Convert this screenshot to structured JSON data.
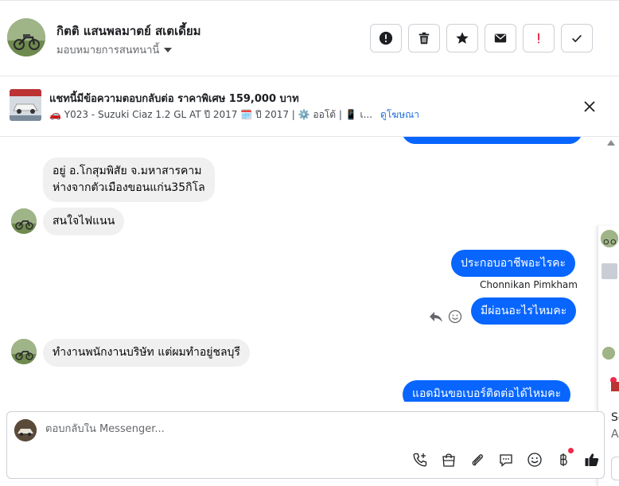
{
  "header": {
    "contact_name": "กิตติ แสนพลมาตย์ สเตเดี้ยม",
    "assign_label": "มอบหมายการสนทนานี้"
  },
  "actions": [
    {
      "name": "spam-button",
      "icon": "exclamation-circle-icon"
    },
    {
      "name": "delete-button",
      "icon": "trash-icon"
    },
    {
      "name": "star-button",
      "icon": "star-icon"
    },
    {
      "name": "mark-unread-button",
      "icon": "envelope-icon"
    },
    {
      "name": "mark-followup-button",
      "icon": "red-exclamation-icon"
    },
    {
      "name": "mark-done-button",
      "icon": "checkmark-icon"
    }
  ],
  "ad": {
    "title": "แชทนี้มีข้อความตอบกลับต่อ ราคาพิเศษ 159,000 บาท",
    "details": "🚗 Y023 - Suzuki Ciaz 1.2 GL AT ปี 2017 🗓️ ปี 2017 | ⚙️ ออโต้ | 📱 เ...",
    "link": "ดูโฆษณา"
  },
  "messages": {
    "in_1_line1": "อยู่ อ.โกสุมพิสัย จ.มหาสารคาม",
    "in_1_line2": "ห่างจากตัวเมืองขอนแก่น35กิโล",
    "in_2": "สนใจไฟแนน",
    "out_1": "ประกอบอาชีพอะไรคะ",
    "sender": "Chonnikan Pimkham",
    "out_2": "มีผ่อนอะไรไหมคะ",
    "in_3": "ทำงานพนักงานบริษัท แต่ผมทำอยู่ชลบุรี",
    "out_3": "แอดมินขอเบอร์ติดต่อได้ไหมคะ"
  },
  "composer": {
    "placeholder": "ตอบกลับใน Messenger..."
  },
  "side_panel": {
    "text_1": "Se",
    "text_2": "A"
  },
  "colors": {
    "outgoing_bubble": "#0866ff",
    "incoming_bubble": "#f0f0f0",
    "link": "#216fdb",
    "notif": "#f02849"
  }
}
